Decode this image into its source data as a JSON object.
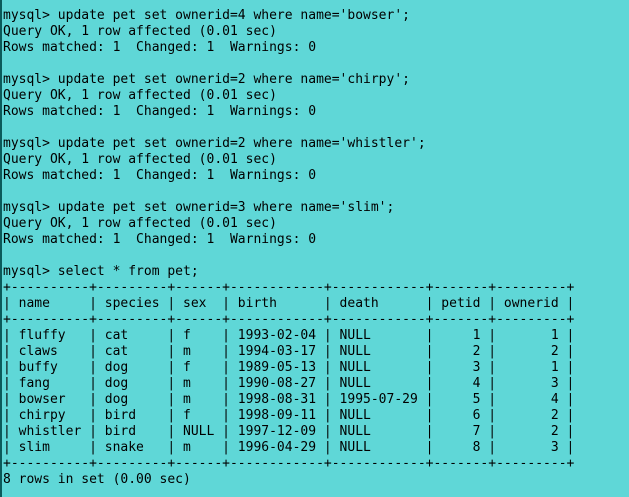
{
  "colors": {
    "background": "#5fd7d7",
    "text": "#000000",
    "left_border": "#0b5a5a"
  },
  "terminal": {
    "lines": [
      "mysql> update pet set ownerid=4 where name='bowser';",
      "Query OK, 1 row affected (0.01 sec)",
      "Rows matched: 1  Changed: 1  Warnings: 0",
      "",
      "mysql> update pet set ownerid=2 where name='chirpy';",
      "Query OK, 1 row affected (0.01 sec)",
      "Rows matched: 1  Changed: 1  Warnings: 0",
      "",
      "mysql> update pet set ownerid=2 where name='whistler';",
      "Query OK, 1 row affected (0.01 sec)",
      "Rows matched: 1  Changed: 1  Warnings: 0",
      "",
      "mysql> update pet set ownerid=3 where name='slim';",
      "Query OK, 1 row affected (0.01 sec)",
      "Rows matched: 1  Changed: 1  Warnings: 0",
      "",
      "mysql> select * from pet;",
      "+----------+---------+------+------------+------------+-------+---------+",
      "| name     | species | sex  | birth      | death      | petid | ownerid |",
      "+----------+---------+------+------------+------------+-------+---------+",
      "| fluffy   | cat     | f    | 1993-02-04 | NULL       |     1 |       1 |",
      "| claws    | cat     | m    | 1994-03-17 | NULL       |     2 |       2 |",
      "| buffy    | dog     | f    | 1989-05-13 | NULL       |     3 |       1 |",
      "| fang     | dog     | m    | 1990-08-27 | NULL       |     4 |       3 |",
      "| bowser   | dog     | m    | 1998-08-31 | 1995-07-29 |     5 |       4 |",
      "| chirpy   | bird    | f    | 1998-09-11 | NULL       |     6 |       2 |",
      "| whistler | bird    | NULL | 1997-12-09 | NULL       |     7 |       2 |",
      "| slim     | snake   | m    | 1996-04-29 | NULL       |     8 |       3 |",
      "+----------+---------+------+------------+------------+-------+---------+",
      "8 rows in set (0.00 sec)"
    ]
  }
}
